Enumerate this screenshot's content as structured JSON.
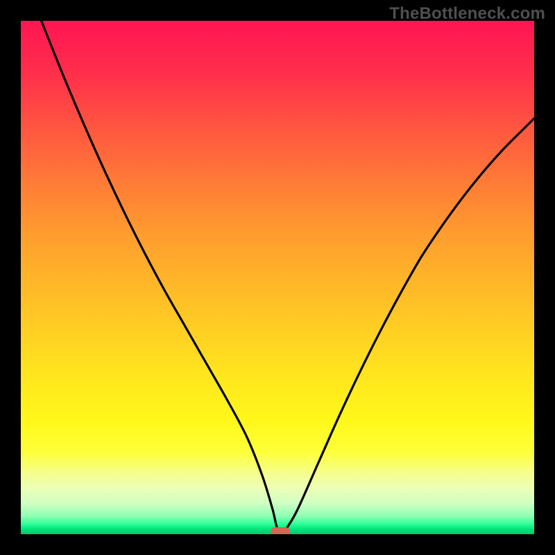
{
  "watermark": {
    "text": "TheBottleneck.com"
  },
  "colors": {
    "background": "#000000",
    "curve": "#000000",
    "marker": "#d76556",
    "watermark": "#4f4f4f",
    "gradient_top": "#ff1553",
    "gradient_bottom": "#00c96b"
  },
  "chart_data": {
    "type": "line",
    "title": "",
    "xlabel": "",
    "ylabel": "",
    "xlim": [
      0,
      100
    ],
    "ylim": [
      0,
      100
    ],
    "grid": false,
    "legend": false,
    "series": [
      {
        "name": "bottleneck-curve",
        "x": [
          4,
          8,
          12,
          16,
          20,
          24,
          28,
          32,
          36,
          40,
          44,
          47,
          49,
          50,
          51,
          52,
          54,
          58,
          62,
          66,
          70,
          74,
          78,
          82,
          86,
          90,
          94,
          98,
          100
        ],
        "y": [
          100,
          90,
          80.5,
          71.5,
          63,
          55,
          47.5,
          40.5,
          33.5,
          26.5,
          19,
          11.5,
          5,
          1,
          0.5,
          1.5,
          5,
          14,
          23,
          31.5,
          39.5,
          47,
          54,
          60,
          65.5,
          70.5,
          75,
          79,
          81
        ]
      }
    ],
    "marker": {
      "x": 50.5,
      "y": 0.6,
      "label": ""
    }
  }
}
